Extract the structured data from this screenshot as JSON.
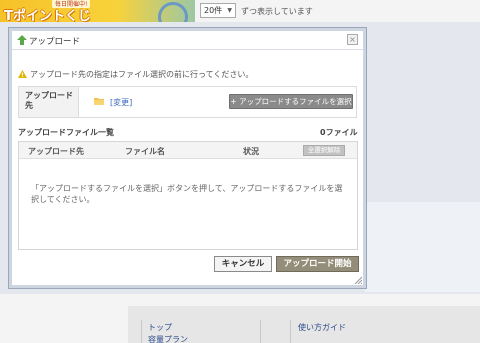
{
  "background": {
    "banner": {
      "subtitle": "毎日開催中!",
      "title": "Tポイントくじ"
    },
    "per_page": {
      "selected": "20件",
      "suffix": "ずつ表示しています"
    },
    "footer": {
      "links": [
        "トップ",
        "容量プラン",
        "使い方ガイド"
      ]
    }
  },
  "dialog": {
    "title": "アップロード",
    "close_glyph": "×",
    "notice": "アップロード先の指定はファイル選択の前に行ってください。",
    "destination": {
      "label": "アップロード先",
      "change_link": "[変更]",
      "select_button": "+ アップロードするファイルを選択"
    },
    "file_list": {
      "title": "アップロードファイル一覧",
      "count": "0ファイル",
      "columns": [
        "アップロード先",
        "ファイル名",
        "状況"
      ],
      "clear_all_button": "全選択解除",
      "empty_message": "「アップロードするファイルを選択」ボタンを押して、アップロードするファイルを選択してください。"
    },
    "buttons": {
      "cancel": "キャンセル",
      "start": "アップロード開始"
    }
  },
  "colors": {
    "accent": "#3b6bbd",
    "primary_button": "#948d79",
    "select_button": "#8a8a8a"
  },
  "icons": [
    "upload-arrow-icon",
    "close-icon",
    "warning-icon",
    "folder-icon",
    "resize-grip-icon"
  ]
}
